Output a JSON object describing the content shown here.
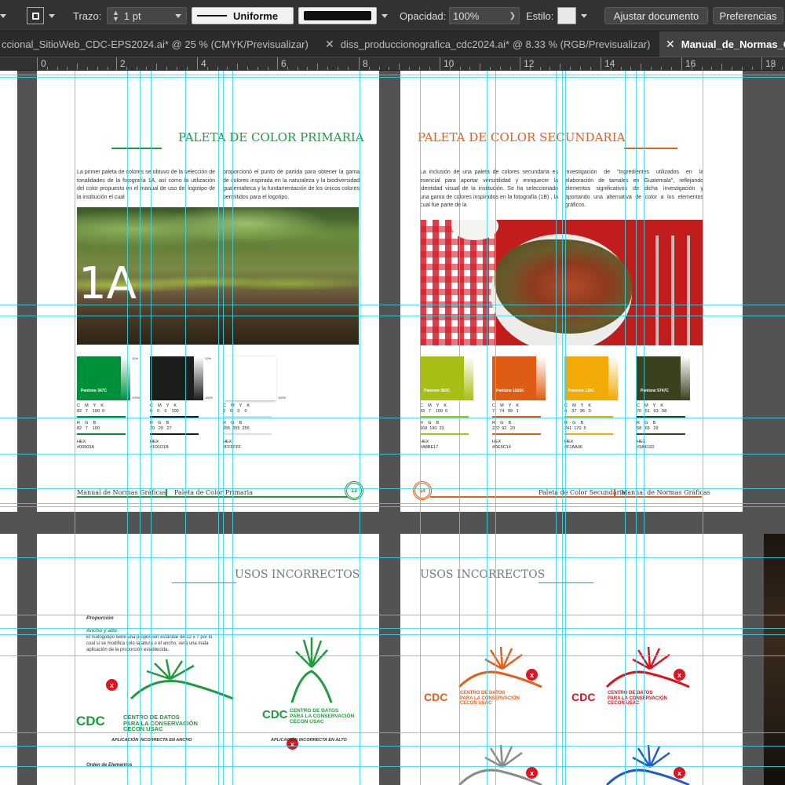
{
  "control_bar": {
    "trazo_label": "Trazo:",
    "trazo_value": "1 pt",
    "stroke_style": "Uniforme",
    "opacity_label": "Opacidad:",
    "opacity_value": "100%",
    "style_label": "Estilo:",
    "adjust_button": "Ajustar documento",
    "prefs_button": "Preferencias"
  },
  "tabs": [
    {
      "label": "ccional_SitioWeb_CDC-EPS2024.ai* @ 25 % (CMYK/Previsualizar)",
      "active": false
    },
    {
      "label": "diss_produccionografica_cdc2024.ai* @ 8.33 % (RGB/Previsualizar)",
      "active": false
    },
    {
      "label": "Manual_de_Normas_G",
      "active": true
    }
  ],
  "ruler": {
    "labels": [
      "0",
      "2",
      "4",
      "6",
      "8",
      "10",
      "12",
      "14",
      "16",
      "18"
    ]
  },
  "page13": {
    "title": "PALETA DE COLOR PRIMARIA",
    "text_left": "La primer paleta de colores se obtuvo de la selección de tonalidades de la fotografía 1A, así como la utilización del color propuesto en el manual de uso del logotipo de la institución el cual",
    "text_right": "proporcionó el punto de partida para obtener la gama de colores inspirada en la naturaleza y la biodiversidad guatemalteca y la fundamentación de los únicos colores permitidos para el logotipo.",
    "photo_label": "1A",
    "swatches": [
      {
        "color": "#00903A",
        "pantone": "Pantone 347C",
        "cmyk_head": "C    M    Y    K",
        "cmyk": "82   7    100  0",
        "rgb_head": "R    G    B",
        "rgb": "82   7    100",
        "hex_head": "HEX",
        "hex": "#00903A",
        "line": "#00903A",
        "top_pct": "10%",
        "bot_pct": "100%"
      },
      {
        "color": "#1D1D1B",
        "pantone": "",
        "cmyk_head": "C    M    Y    K",
        "cmyk": "0    0    0    100",
        "rgb_head": "R    G    B",
        "rgb": "29   29   27",
        "hex_head": "HEX",
        "hex": "#1D1D1B",
        "line": "#1D1D1B",
        "top_pct": "10%",
        "bot_pct": "100%"
      },
      {
        "color": "#FFFFFF",
        "pantone": "",
        "cmyk_head": "C    M    Y    K",
        "cmyk": "0    0    0    0",
        "rgb_head": "R    G    B",
        "rgb": "255  255  255",
        "hex_head": "HEX",
        "hex": "#FFFFFF",
        "line": "#dddddd",
        "top_pct": "",
        "bot_pct": "100%"
      }
    ],
    "footer_left": "Manual de Normas Gráficas",
    "footer_section": "Paleta de Color Primaria",
    "page_number": "13",
    "accent": "#1e9b3c"
  },
  "page14": {
    "title": "PALETA DE COLOR SECUNDARIA",
    "text_left": "La inclusión de una paleta de colores secundaria es esencial para aportar versatilidad y enriquecer la identidad visual de la institución. Se ha seleccionado una gama de colores inspirados en la fotografía (1B) , la cual fue parte de la",
    "text_right": "investigación de \"Ingredientes utilizados en la elaboración de tamales en Guatemala\", reflejando elementos significativos de dicha investigación y aportando una alternativa de color a los elementos gráficos.",
    "swatches": [
      {
        "color": "#A8BE17",
        "pantone": "Pantone 583C",
        "cmyk_head": "C    M    Y    K",
        "cmyk": "43   7    100  0",
        "rgb_head": "R    G    B",
        "rgb": "168  190  23",
        "hex_head": "HEX",
        "hex": "#A8BE17",
        "line": "#A8BE17"
      },
      {
        "color": "#DE5C14",
        "pantone": "Pantone 1595C",
        "cmyk_head": "C    M    Y    K",
        "cmyk": "7    74   99   1",
        "rgb_head": "R    G    B",
        "rgb": "222  92   20",
        "hex_head": "HEX",
        "hex": "#DE5C14",
        "line": "#DE5C14"
      },
      {
        "color": "#F1AA06",
        "pantone": "Pantone 130C",
        "cmyk_head": "C    M    Y    K",
        "cmyk": "4    37   96   0",
        "rgb_head": "R    G    B",
        "rgb": "241  170  5",
        "hex_head": "HEX",
        "hex": "#F1AA06",
        "line": "#F1AA06"
      },
      {
        "color": "#3A411D",
        "pantone": "Pantone 5747C",
        "cmyk_head": "C    M    Y    K",
        "cmyk": "70   51   93   58",
        "rgb_head": "R    G    B",
        "rgb": "58   65   29",
        "hex_head": "HEX",
        "hex": "#3A411D",
        "line": "#3A411D"
      }
    ],
    "footer_section": "Paleta de Color Secundaria",
    "footer_right": "Manual de Normas Gráficas",
    "page_number": "14",
    "accent": "#e0601c"
  },
  "page15": {
    "title": "USOS INCORRECTOS",
    "section": "Proporción",
    "subsection": "Ancho y alto",
    "body": "El Isologotipo tiene una proporción estándar de 12 x 7 por lo cual si se modifica solo la altura o el ancho, será una mala aplicación de la proporción establecida.",
    "caption_wide": "APLICACIÓN INCORRECTA EN ANCHO",
    "caption_tall": "APLICACIÓN INCORRECTA EN ALTO",
    "section2": "Orden de Elementos",
    "logo_cdc": "CDC",
    "logo_line1": "CENTRO DE DATOS",
    "logo_line2": "PARA LA CONSERVACIÓN",
    "logo_line3": "CECON USAC",
    "x_label": "x"
  },
  "page16": {
    "title": "USOS INCORRECTOS",
    "logo_cdc": "CDC",
    "logo_line1": "CENTRO DE DATOS",
    "logo_line2": "PARA LA CONSERVACIÓN",
    "logo_line3": "CECON USAC",
    "x_label": "x"
  }
}
